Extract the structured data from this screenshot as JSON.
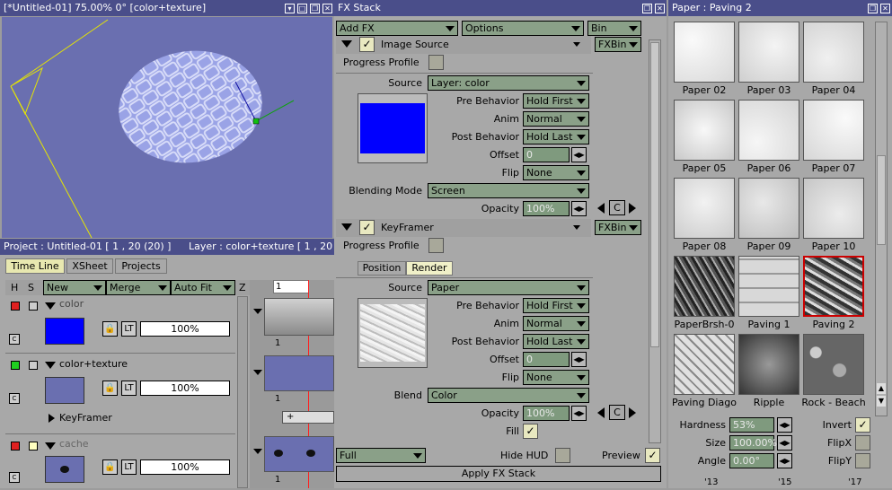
{
  "viewer": {
    "title": "[*Untitled-01]  75.00%  0°  [color+texture]"
  },
  "fx": {
    "title": "FX Stack",
    "add_fx": "Add FX",
    "options": "Options",
    "bin": "Bin",
    "s1": {
      "name": "Image Source",
      "bin_btn": "FXBin",
      "progress": "Progress Profile",
      "source_label": "Source",
      "source": "Layer: color",
      "pre_label": "Pre Behavior",
      "pre": "Hold First",
      "anim_label": "Anim",
      "anim": "Normal",
      "post_label": "Post Behavior",
      "post": "Hold Last",
      "offset_label": "Offset",
      "offset": "0",
      "flip_label": "Flip",
      "flip": "None",
      "blend_label": "Blending Mode",
      "blend": "Screen",
      "opacity_label": "Opacity",
      "opacity": "100%",
      "c": "C"
    },
    "s2": {
      "name": "KeyFramer",
      "bin_btn": "FXBin",
      "progress": "Progress Profile",
      "tab_position": "Position",
      "tab_render": "Render",
      "source_label": "Source",
      "source": "Paper",
      "pre_label": "Pre Behavior",
      "pre": "Hold First",
      "anim_label": "Anim",
      "anim": "Normal",
      "post_label": "Post Behavior",
      "post": "Hold Last",
      "offset_label": "Offset",
      "offset": "0",
      "flip_label": "Flip",
      "flip": "None",
      "blend_label": "Blend",
      "blend": "Color",
      "opacity_label": "Opacity",
      "opacity": "100%",
      "fill_label": "Fill",
      "c": "C"
    },
    "quality": "Full",
    "hide_hud": "Hide HUD",
    "preview": "Preview",
    "apply": "Apply FX Stack"
  },
  "paper": {
    "title": "Paper : Paving 2",
    "items": [
      "Paper 02",
      "Paper 03",
      "Paper 04",
      "Paper 05",
      "Paper 06",
      "Paper 07",
      "Paper 08",
      "Paper 09",
      "Paper 10",
      "PaperBrsh-0",
      "Paving 1",
      "Paving 2",
      "Paving Diago",
      "Ripple",
      "Rock - Beach"
    ],
    "selected": "Paving 2",
    "hardness_label": "Hardness",
    "hardness": "53%",
    "size_label": "Size",
    "size": "100.00%",
    "angle_label": "Angle",
    "angle": "0.00°",
    "invert": "Invert",
    "flipx": "FlipX",
    "flipy": "FlipY"
  },
  "project": {
    "title": "Project : Untitled-01 [ 1 , 20  (20) ]",
    "layer_title": "Layer : color+texture [ 1 , 20",
    "tabs": [
      "Time Line",
      "XSheet",
      "Projects"
    ],
    "cols": {
      "h": "H",
      "s": "S",
      "new": "New",
      "merge": "Merge",
      "autofit": "Auto Fit",
      "z": "Z"
    },
    "layers": [
      {
        "name": "color",
        "opacity": "100%",
        "lt": "LT"
      },
      {
        "name": "color+texture",
        "opacity": "100%",
        "lt": "LT",
        "child": "KeyFramer"
      },
      {
        "name": "cache",
        "opacity": "100%",
        "lt": "LT"
      }
    ],
    "frame": "1",
    "frame_labels": [
      "1",
      "1",
      "1"
    ],
    "plus": "+",
    "ticks": [
      "'13",
      "'15",
      "'17"
    ]
  },
  "colors": {
    "titlebar": "#4a4e8a",
    "viewport": "#6a6fb0",
    "blue": "#0000ff",
    "selected": "#cc0000"
  }
}
